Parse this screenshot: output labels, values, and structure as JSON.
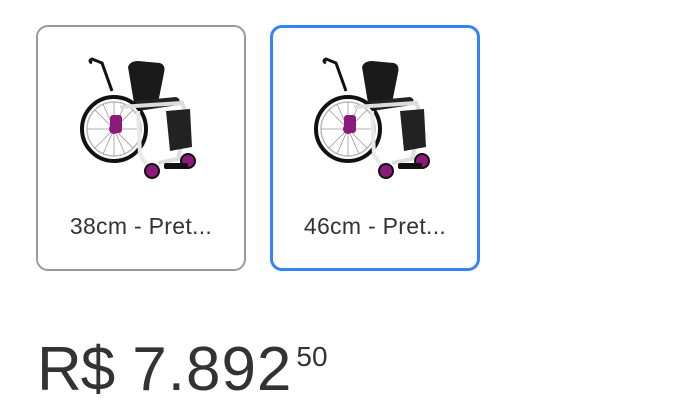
{
  "variants": [
    {
      "label": "38cm - Pret...",
      "image": "wheelchair-image",
      "selected": false
    },
    {
      "label": "46cm - Pret...",
      "image": "wheelchair-image",
      "selected": true
    }
  ],
  "price": {
    "currency": "R$",
    "amount": "7.892",
    "cents": "50"
  },
  "colors": {
    "selected_border": "#3483fa",
    "default_border": "#9a9a9a",
    "text": "#333333",
    "wheelchair_frame": "#111111",
    "wheelchair_accent": "#8b1a7a"
  }
}
